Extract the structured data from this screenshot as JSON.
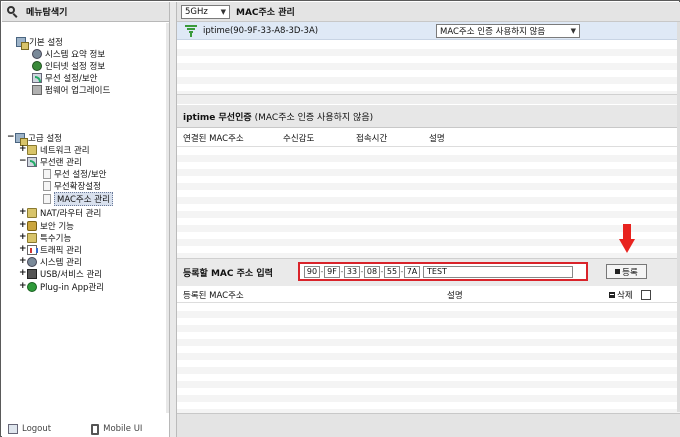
{
  "sidebar": {
    "title": "메뉴탐색기",
    "basic": {
      "label": "기본 설정",
      "items": [
        "시스템 요약 정보",
        "인터넷 설정 정보",
        "무선 설정/보안",
        "펌웨어 업그레이드"
      ]
    },
    "advanced": {
      "label": "고급 설정",
      "network": "네트워크 관리",
      "wireless": "무선랜 관리",
      "wireless_items": [
        "무선 설정/보안",
        "무선확장설정",
        "MAC주소 관리"
      ],
      "rest": [
        "NAT/라우터 관리",
        "보안 기능",
        "특수기능",
        "트래픽 관리",
        "시스템 관리",
        "USB/서비스 관리",
        "Plug-in App관리"
      ]
    },
    "footer": {
      "logout": "Logout",
      "mobile": "Mobile UI"
    }
  },
  "header": {
    "band": "5GHz",
    "title": "MAC주소 관리"
  },
  "ap": {
    "name": "iptime(90-9F-33-A8-3D-3A)",
    "auth_mode": "MAC주소 인증 사용하지 않음"
  },
  "wireless_auth": {
    "title_bold": "iptime 무선인증",
    "title_note": "(MAC주소 인증 사용하지 않음)",
    "columns": [
      "연결된 MAC주소",
      "수신감도",
      "접속시간",
      "설명"
    ]
  },
  "register": {
    "label": "등록할 MAC 주소 입력",
    "mac": [
      "90",
      "9F",
      "33",
      "08",
      "55",
      "7A"
    ],
    "description": "TEST",
    "button": "등록"
  },
  "mac_list": {
    "columns": [
      "등록된 MAC주소",
      "설명"
    ],
    "delete_label": "삭제"
  },
  "colors": {
    "highlight_box": "#d9232a",
    "arrow": "#e8231f",
    "selected_row": "#dfe9f6"
  }
}
